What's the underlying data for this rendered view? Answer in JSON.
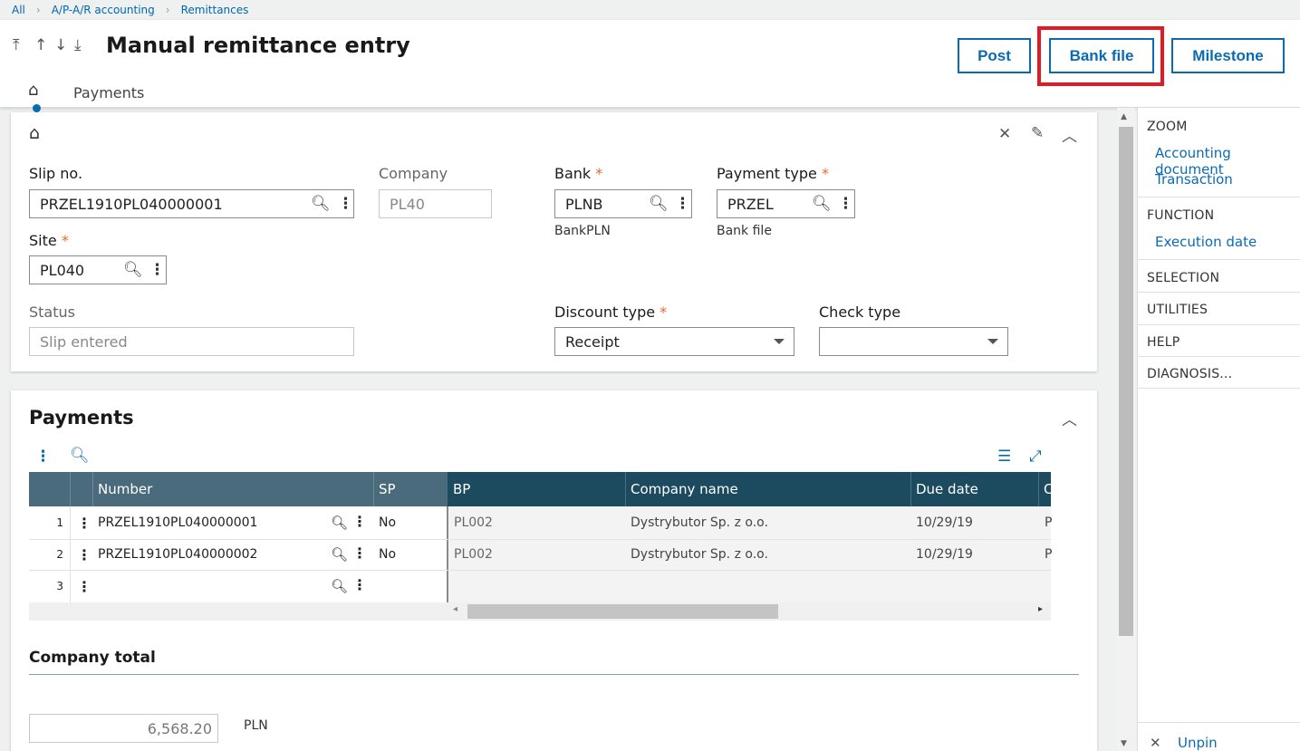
{
  "breadcrumb": {
    "items": [
      "All",
      "A/P-A/R accounting",
      "Remittances"
    ]
  },
  "header": {
    "title": "Manual remittance entry",
    "buttons": {
      "post": "Post",
      "bank_file": "Bank file",
      "milestone": "Milestone"
    },
    "tabs": {
      "payments": "Payments"
    }
  },
  "form": {
    "slip_no": {
      "label": "Slip no.",
      "value": "PRZEL1910PL040000001"
    },
    "company": {
      "label": "Company",
      "value": "PL40"
    },
    "bank": {
      "label": "Bank",
      "value": "PLNB",
      "sub": "BankPLN"
    },
    "payment_type": {
      "label": "Payment type",
      "value": "PRZEL",
      "sub": "Bank file"
    },
    "site": {
      "label": "Site",
      "value": "PL040"
    },
    "status": {
      "label": "Status",
      "value": "Slip entered"
    },
    "discount_type": {
      "label": "Discount type",
      "value": "Receipt"
    },
    "check_type": {
      "label": "Check type",
      "value": ""
    },
    "required_mark": "*"
  },
  "payments": {
    "title": "Payments",
    "columns": {
      "number": "Number",
      "sp": "SP",
      "bp": "BP",
      "company_name": "Company name",
      "due_date": "Due date",
      "next": "C"
    },
    "rows": [
      {
        "idx": "1",
        "number": "PRZEL1910PL040000001",
        "sp": "No",
        "bp": "PL002",
        "company_name": "Dystrybutor Sp. z o.o.",
        "due_date": "10/29/19",
        "next": "P"
      },
      {
        "idx": "2",
        "number": "PRZEL1910PL040000002",
        "sp": "No",
        "bp": "PL002",
        "company_name": "Dystrybutor Sp. z o.o.",
        "due_date": "10/29/19",
        "next": "P"
      },
      {
        "idx": "3",
        "number": "",
        "sp": "",
        "bp": "",
        "company_name": "",
        "due_date": "",
        "next": ""
      }
    ]
  },
  "company_total": {
    "title": "Company total",
    "value": "6,568.20",
    "currency": "PLN"
  },
  "sidebar": {
    "zoom": "ZOOM",
    "zoom_items": [
      "Accounting document",
      "Transaction"
    ],
    "function": "FUNCTION",
    "function_items": [
      "Execution date"
    ],
    "selection": "SELECTION",
    "utilities": "UTILITIES",
    "help": "HELP",
    "diagnosis": "DIAGNOSIS...",
    "unpin": "Unpin"
  },
  "colors": {
    "accent": "#0a6bb3",
    "grid_header_left": "#4a6b7c",
    "grid_header_right": "#1c4a5e",
    "highlight": "#e01b24",
    "required": "#e8672d"
  }
}
